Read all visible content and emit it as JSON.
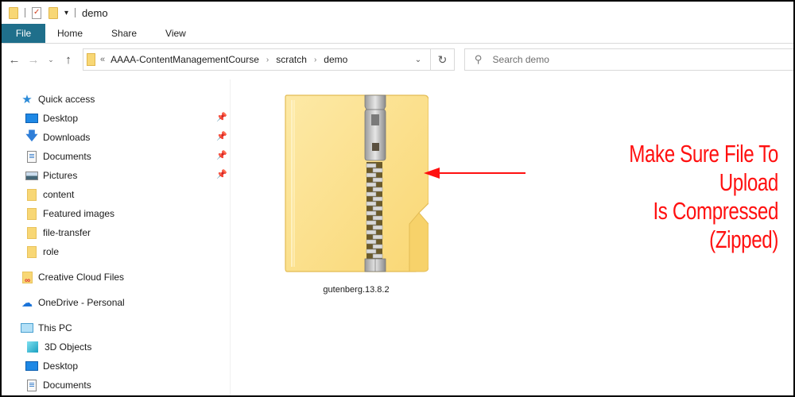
{
  "window": {
    "title": "demo",
    "quick_access_toolbar": [
      "folder-icon",
      "properties-icon",
      "new-folder-icon",
      "customize-dropdown"
    ]
  },
  "ribbon": {
    "tabs": [
      {
        "label": "File",
        "active": true
      },
      {
        "label": "Home"
      },
      {
        "label": "Share"
      },
      {
        "label": "View"
      }
    ],
    "file_tab_color": "#1f6f8b"
  },
  "navigation": {
    "back": "←",
    "forward": "→",
    "recent": "⌄",
    "up": "↑",
    "address": {
      "overflow": "«",
      "crumbs": [
        "AAAA-ContentManagementCourse",
        "scratch",
        "demo"
      ],
      "separator": "›",
      "dropdown": "⌄",
      "refresh": "↻"
    },
    "search": {
      "placeholder": "Search demo",
      "icon": "⚲"
    }
  },
  "sidebar": {
    "quick_access": {
      "label": "Quick access"
    },
    "quick_items": [
      {
        "label": "Desktop",
        "pinned": true
      },
      {
        "label": "Downloads",
        "pinned": true
      },
      {
        "label": "Documents",
        "pinned": true
      },
      {
        "label": "Pictures",
        "pinned": true
      },
      {
        "label": "content"
      },
      {
        "label": "Featured images"
      },
      {
        "label": "file-transfer"
      },
      {
        "label": "role"
      }
    ],
    "creative_cloud": {
      "label": "Creative Cloud Files"
    },
    "onedrive": {
      "label": "OneDrive - Personal"
    },
    "this_pc": {
      "label": "This PC"
    },
    "pc_items": [
      {
        "label": "3D Objects"
      },
      {
        "label": "Desktop"
      },
      {
        "label": "Documents"
      }
    ],
    "pin_glyph": "📌"
  },
  "content": {
    "files": [
      {
        "name": "gutenberg.13.8.2",
        "type": "compressed-zip-folder"
      }
    ],
    "annotation": {
      "lines": [
        "Make Sure File To Upload",
        "Is Compressed (Zipped)"
      ],
      "color": "#ff1010"
    }
  }
}
